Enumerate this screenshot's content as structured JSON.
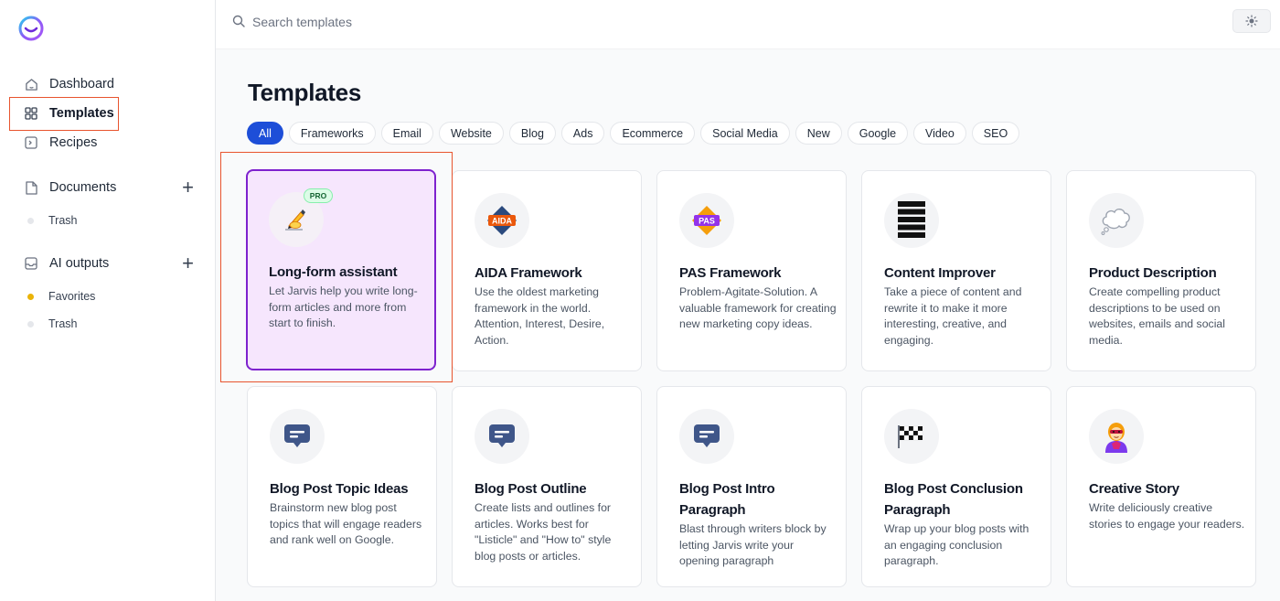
{
  "sidebar": {
    "items": [
      {
        "label": "Dashboard"
      },
      {
        "label": "Templates"
      },
      {
        "label": "Recipes"
      },
      {
        "label": "Documents"
      },
      {
        "label": "AI outputs"
      }
    ],
    "documents_sub": [
      {
        "label": "Trash"
      }
    ],
    "outputs_sub": [
      {
        "label": "Favorites"
      },
      {
        "label": "Trash"
      }
    ]
  },
  "search": {
    "placeholder": "Search templates"
  },
  "page": {
    "title": "Templates"
  },
  "tabs": [
    "All",
    "Frameworks",
    "Email",
    "Website",
    "Blog",
    "Ads",
    "Ecommerce",
    "Social Media",
    "New",
    "Google",
    "Video",
    "SEO"
  ],
  "cards": [
    {
      "title": "Long-form assistant",
      "desc": "Let Jarvis help you write long-form articles and more from start to finish.",
      "badge": "PRO",
      "icon": "writing-hand-icon"
    },
    {
      "title": "AIDA Framework",
      "desc": "Use the oldest marketing framework in the world. Attention, Interest, Desire, Action.",
      "icon_text": "AIDA",
      "icon": "aida-icon"
    },
    {
      "title": "PAS Framework",
      "desc": "Problem-Agitate-Solution. A valuable framework for creating new marketing copy ideas.",
      "icon_text": "PAS",
      "icon": "pas-icon"
    },
    {
      "title": "Content Improver",
      "desc": "Take a piece of content and rewrite it to make it more interesting, creative, and engaging.",
      "icon": "stacked-lines-icon"
    },
    {
      "title": "Product Description",
      "desc": "Create compelling product descriptions to be used on websites, emails and social media.",
      "icon": "thought-bubble-icon"
    },
    {
      "title": "Blog Post Topic Ideas",
      "desc": "Brainstorm new blog post topics that will engage readers and rank well on Google.",
      "icon": "chat-bubble-icon"
    },
    {
      "title": "Blog Post Outline",
      "desc": "Create lists and outlines for articles. Works best for \"Listicle\" and \"How to\" style blog posts or articles.",
      "icon": "chat-bubble-icon"
    },
    {
      "title": "Blog Post Intro Paragraph",
      "desc": "Blast through writers block by letting Jarvis write your opening paragraph",
      "icon": "chat-bubble-icon"
    },
    {
      "title": "Blog Post Conclusion Paragraph",
      "desc": "Wrap up your blog posts with an engaging conclusion paragraph.",
      "icon": "checkered-flag-icon"
    },
    {
      "title": "Creative Story",
      "desc": "Write deliciously creative stories to engage your readers.",
      "icon": "superhero-icon"
    }
  ],
  "colors": {
    "accent": "#1d4ed8",
    "selected_bg": "#f6e6fd",
    "selected_border": "#7e22ce",
    "highlight": "#e8542e"
  }
}
